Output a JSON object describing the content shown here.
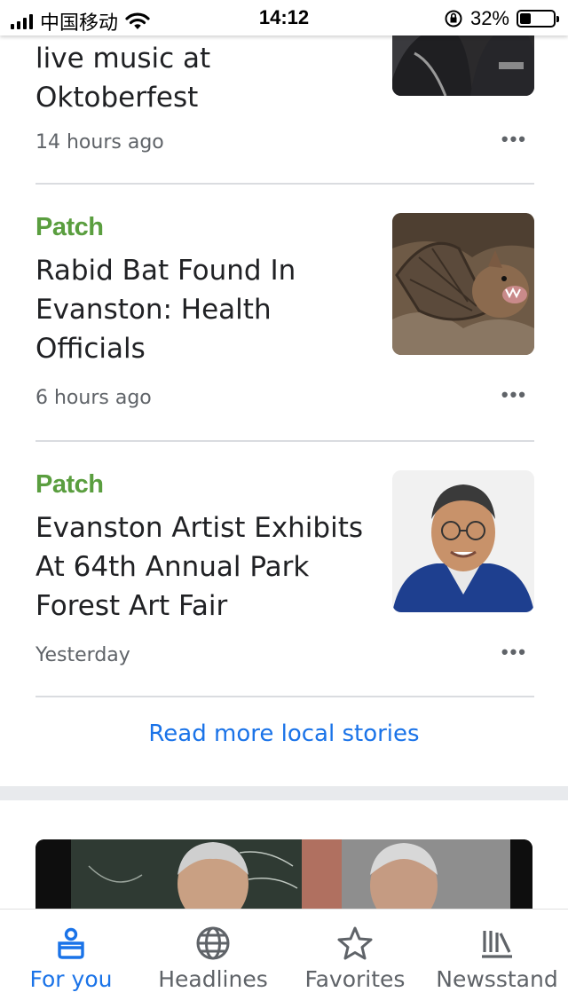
{
  "status_bar": {
    "carrier": "中国移动",
    "time": "14:12",
    "battery_percent": "32%",
    "battery_level": 0.32
  },
  "articles": [
    {
      "headline_lines": [
        "live music at",
        "Oktoberfest"
      ],
      "time": "14 hours ago",
      "image": "photo-people-oktoberfest"
    },
    {
      "source": "Patch",
      "headline_lines": [
        "Rabid Bat Found In",
        "Evanston: Health",
        "Officials"
      ],
      "time": "6 hours ago",
      "image": "photo-bat"
    },
    {
      "source": "Patch",
      "headline_lines": [
        "Evanston Artist Exhibits",
        "At 64th Annual Park",
        "Forest Art Fair"
      ],
      "time": "Yesterday",
      "image": "photo-artist-portrait"
    }
  ],
  "more_options_icon": "more-horiz-icon",
  "read_more": "Read more local stories",
  "bottom_nav": {
    "items": [
      {
        "label": "For you",
        "icon": "for-you-icon",
        "active": true
      },
      {
        "label": "Headlines",
        "icon": "globe-icon",
        "active": false
      },
      {
        "label": "Favorites",
        "icon": "star-icon",
        "active": false
      },
      {
        "label": "Newsstand",
        "icon": "newsstand-icon",
        "active": false
      }
    ]
  },
  "colors": {
    "accent": "#1a73e8",
    "patch_green": "#5a9e3f",
    "divider": "#dadce0"
  }
}
